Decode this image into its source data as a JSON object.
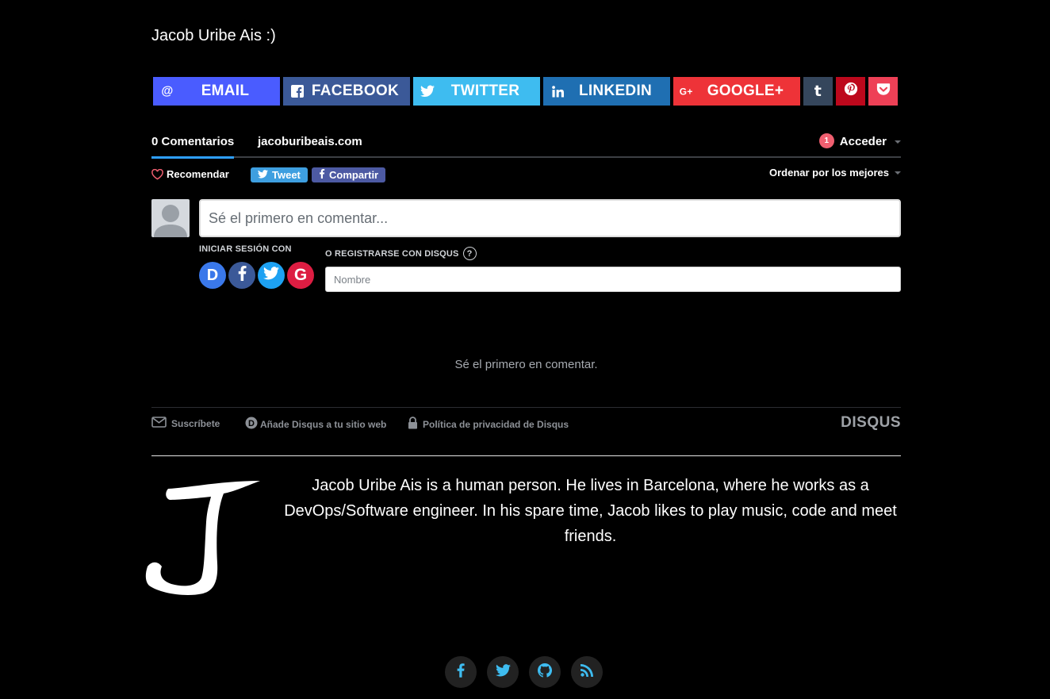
{
  "author": {
    "name": "Jacob Uribe Ais :)"
  },
  "share": {
    "email": "EMAIL",
    "facebook": "FACEBOOK",
    "twitter": "TWITTER",
    "linkedin": "LINKEDIN",
    "google": "GOOGLE+",
    "tumblr_icon": "t"
  },
  "disqus": {
    "comments_tab": "0 Comentarios",
    "site_tab": "jacoburibeais.com",
    "notification_count": "1",
    "login": "Acceder",
    "recommend": "Recomendar",
    "tweet": "Tweet",
    "share": "Compartir",
    "sort": "Ordenar por los mejores",
    "comment_placeholder": "Sé el primero en comentar...",
    "signin_label": "INICIAR SESIÓN CON",
    "register_label": "O REGISTRARSE CON DISQUS",
    "help": "?",
    "name_placeholder": "Nombre",
    "empty": "Sé el primero en comentar.",
    "subscribe": "Suscríbete",
    "add_disqus": "Añade Disqus a tu sitio web",
    "privacy": "Política de privacidad de Disqus",
    "logo": "DISQUS"
  },
  "bio": {
    "text": "Jacob Uribe Ais is a human person. He lives in Barcelona, where he works as a DevOps/Software engineer. In his spare time, Jacob likes to play music, code and meet friends."
  },
  "footer": {
    "icons": [
      "facebook-icon",
      "twitter-icon",
      "github-icon",
      "rss-icon"
    ]
  },
  "colors": {
    "accent": "#2e9fff",
    "footer_icon": "#3ebcf0"
  }
}
